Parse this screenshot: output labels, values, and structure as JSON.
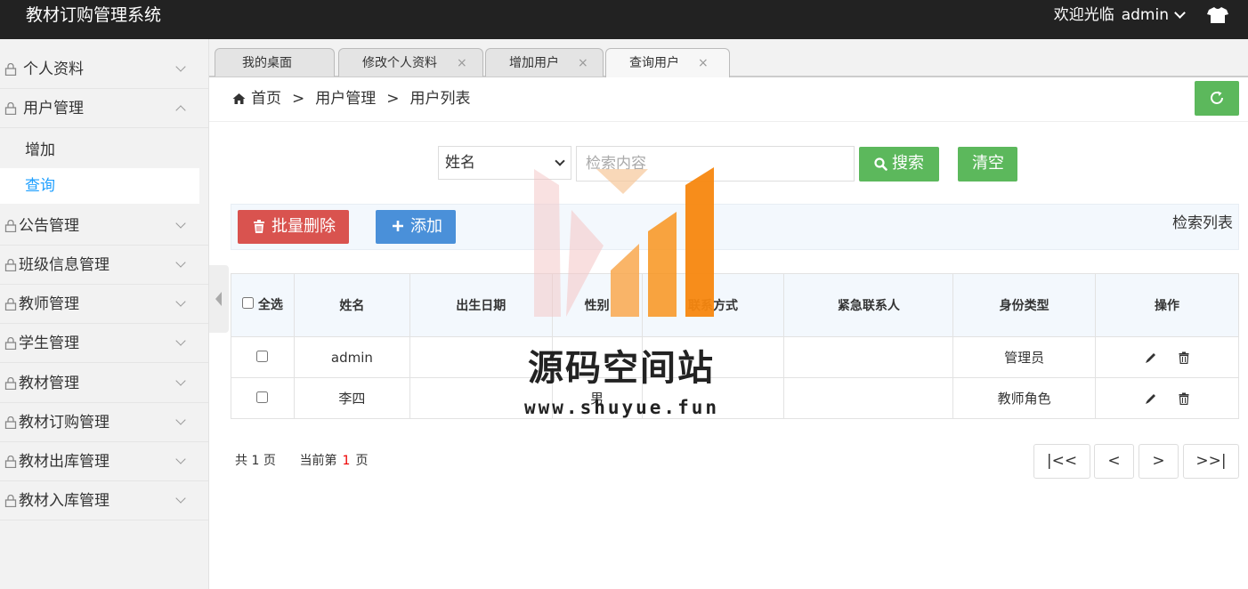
{
  "header": {
    "app_title": "教材订购管理系统",
    "welcome": "欢迎光临",
    "user": "admin"
  },
  "sidebar": {
    "items": [
      {
        "label": "个人资料"
      },
      {
        "label": "用户管理",
        "expanded": true,
        "children": [
          {
            "label": "增加"
          },
          {
            "label": "查询",
            "active": true
          }
        ]
      },
      {
        "label": "公告管理"
      },
      {
        "label": "班级信息管理"
      },
      {
        "label": "教师管理"
      },
      {
        "label": "学生管理"
      },
      {
        "label": "教材管理"
      },
      {
        "label": "教材订购管理"
      },
      {
        "label": "教材出库管理"
      },
      {
        "label": "教材入库管理"
      }
    ]
  },
  "tabs": [
    {
      "label": "我的桌面"
    },
    {
      "label": "修改个人资料",
      "close": "×"
    },
    {
      "label": "增加用户",
      "close": "×"
    },
    {
      "label": "查询用户",
      "close": "×",
      "active": true
    }
  ],
  "breadcrumb": {
    "home": "首页",
    "sep": ">",
    "level2": "用户管理",
    "level3": "用户列表"
  },
  "search": {
    "field": "姓名",
    "placeholder": "检索内容",
    "search_label": "搜索",
    "clear_label": "清空"
  },
  "toolbar": {
    "batch_delete": "批量删除",
    "add": "添加",
    "list_title": "检索列表"
  },
  "table": {
    "select_all": "全选",
    "columns": [
      "姓名",
      "出生日期",
      "性别",
      "联系方式",
      "紧急联系人",
      "身份类型",
      "操作"
    ],
    "rows": [
      {
        "name": "admin",
        "birth": "",
        "gender": "",
        "phone": "",
        "emergency": "",
        "role": "管理员"
      },
      {
        "name": "李四",
        "birth": "",
        "gender": "男",
        "phone": "",
        "emergency": "",
        "role": "教师角色"
      }
    ]
  },
  "pager": {
    "total_prefix": "共",
    "total": "1",
    "page_unit": "页",
    "current_prefix": "当前第",
    "current": "1",
    "first": "|<<",
    "prev": "<",
    "next": ">",
    "last": ">>|"
  },
  "watermark": {
    "text": "源码空间站",
    "url": "www.shuyue.fun"
  },
  "colors": {
    "topbar": "#222222",
    "green": "#5cb85c",
    "red": "#d9534f",
    "blue": "#4a90d9",
    "active_link": "#1e9fff"
  }
}
